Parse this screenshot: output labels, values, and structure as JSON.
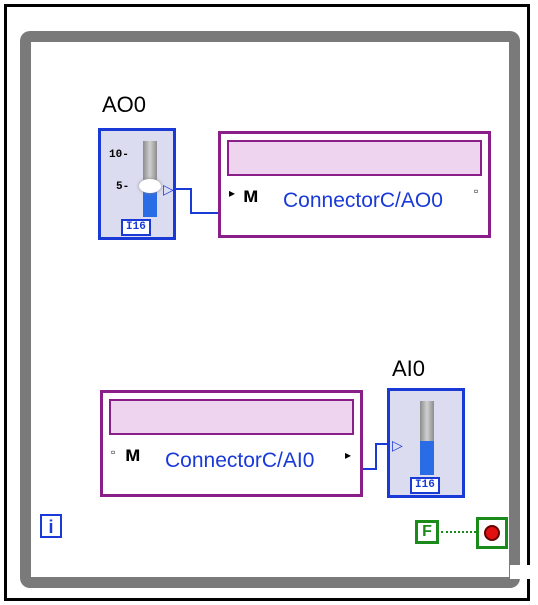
{
  "loop": {
    "iteration_terminal": "i",
    "stop_constant": "F"
  },
  "ao0": {
    "label": "AO0",
    "tick_high": "10-",
    "tick_mid": "5-",
    "dtype": "I16",
    "io_constant": "ConnectorC/AO0"
  },
  "ai0": {
    "label": "AI0",
    "dtype": "I16",
    "io_constant": "ConnectorC/AI0"
  },
  "icons": {
    "waveform": "waveform-icon",
    "stop": "stop-button-icon"
  },
  "colors": {
    "loop_border": "#7a7a7a",
    "wire_blue": "#1a3ad8",
    "io_purple": "#8a1f8a",
    "io_fill": "#eed4ee",
    "boolean_green": "#1a8a1a",
    "stop_red": "#e01010"
  }
}
